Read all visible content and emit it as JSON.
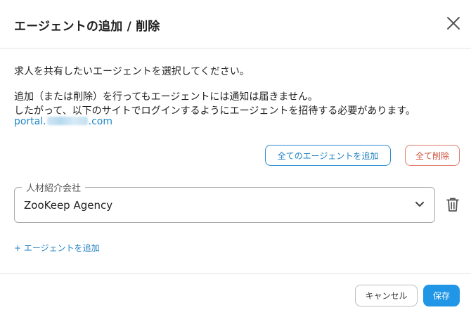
{
  "dialog": {
    "title": "エージェントの追加 / 削除",
    "close_icon": "close-icon"
  },
  "body": {
    "line1": "求人を共有したいエージェントを選択してください。",
    "line2": "追加（または削除）を行ってもエージェントには通知は届きません。",
    "line3": "したがって、以下のサイトでログインするようにエージェントを招待する必要があります。",
    "link_prefix": "portal.",
    "link_suffix": ".com"
  },
  "actions": {
    "add_all_label": "全てのエージェントを追加",
    "delete_all_label": "全て削除"
  },
  "agent_field": {
    "label": "人材紹介会社",
    "value": "ZooKeep Agency",
    "dropdown_icon": "chevron-down-icon",
    "remove_icon": "trash-icon"
  },
  "add_agent_label": "+ エージェントを追加",
  "footer": {
    "cancel_label": "キャンセル",
    "save_label": "保存"
  },
  "colors": {
    "accent": "#2196e6",
    "link": "#1e88c7",
    "danger": "#d0503c"
  }
}
